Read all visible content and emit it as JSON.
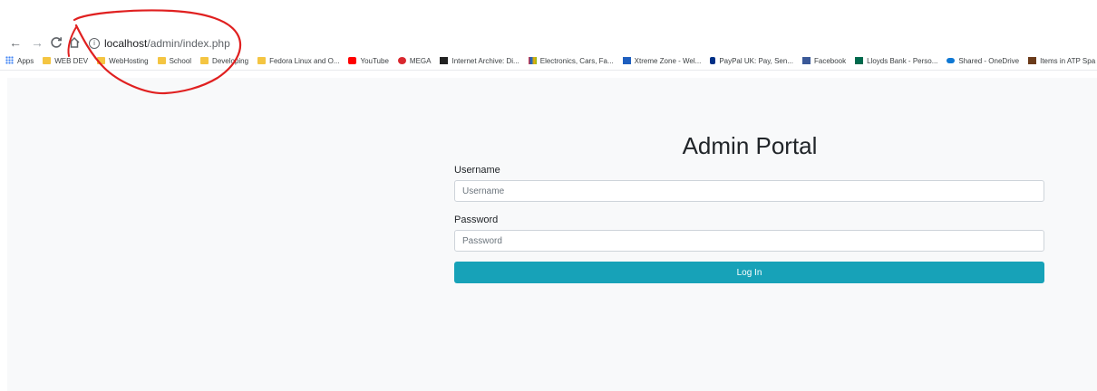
{
  "browser": {
    "url_host": "localhost",
    "url_path": "/admin/index.php",
    "bookmarks": [
      {
        "label": "Apps",
        "icon": "apps-grid-icon"
      },
      {
        "label": "WEB DEV",
        "icon": "folder-icon"
      },
      {
        "label": "WebHosting",
        "icon": "folder-icon"
      },
      {
        "label": "School",
        "icon": "folder-icon"
      },
      {
        "label": "Developing",
        "icon": "folder-icon"
      },
      {
        "label": "Fedora Linux and O...",
        "icon": "folder-icon"
      },
      {
        "label": "YouTube",
        "icon": "youtube-icon"
      },
      {
        "label": "MEGA",
        "icon": "mega-icon"
      },
      {
        "label": "Internet Archive: Di...",
        "icon": "internet-archive-icon"
      },
      {
        "label": "Electronics, Cars, Fa...",
        "icon": "ebay-icon"
      },
      {
        "label": "Xtreme Zone - Wel...",
        "icon": "xtreme-icon"
      },
      {
        "label": "PayPal UK: Pay, Sen...",
        "icon": "paypal-icon"
      },
      {
        "label": "Facebook",
        "icon": "facebook-icon"
      },
      {
        "label": "Lloyds Bank - Perso...",
        "icon": "lloyds-icon"
      },
      {
        "label": "Shared - OneDrive",
        "icon": "onedrive-icon"
      },
      {
        "label": "Items in ATP Spa",
        "icon": "atp-icon"
      }
    ]
  },
  "login": {
    "title": "Admin Portal",
    "username_label": "Username",
    "username_placeholder": "Username",
    "username_value": "",
    "password_label": "Password",
    "password_placeholder": "Password",
    "password_value": "",
    "submit_label": "Log In"
  },
  "colors": {
    "accent": "#17a2b8",
    "annotation": "#e02020",
    "panel_background": "#f8f9fa"
  }
}
